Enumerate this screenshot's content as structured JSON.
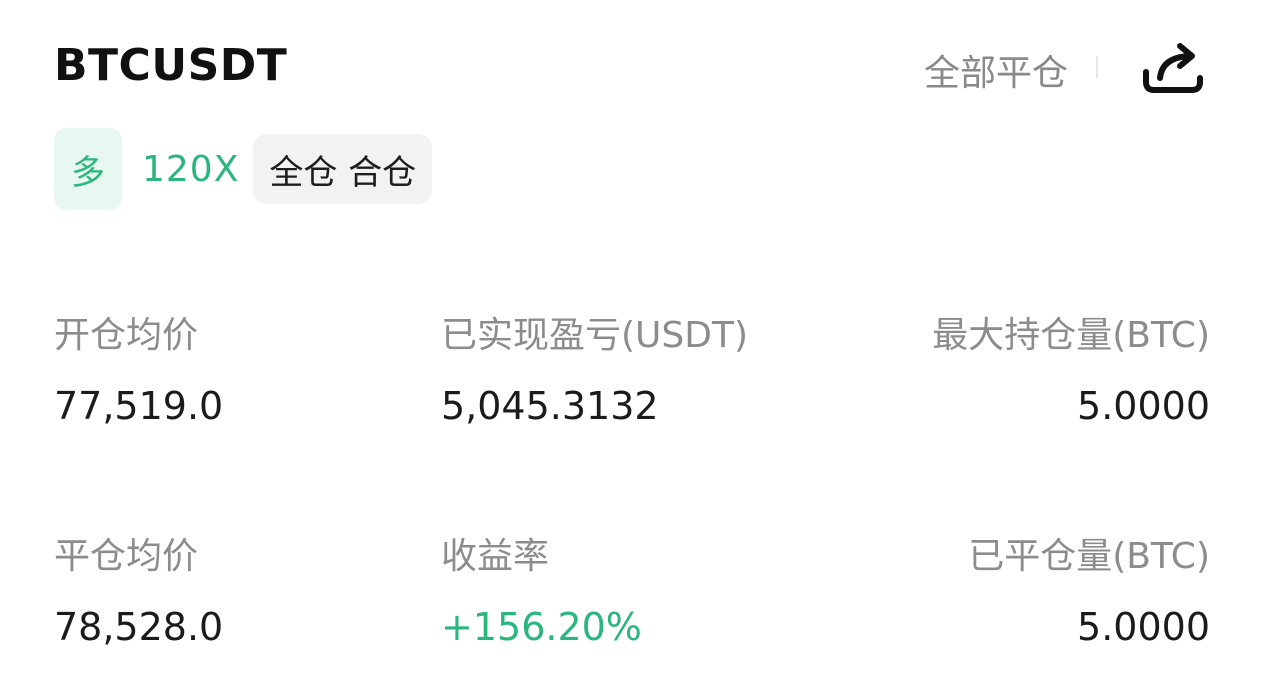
{
  "header": {
    "symbol": "BTCUSDT",
    "close_all_label": "全部平仓",
    "share_icon": "share-icon"
  },
  "tags": {
    "side": "多",
    "leverage": "120X",
    "margin_mode": "全仓 合仓"
  },
  "stats": {
    "open_avg_price": {
      "label": "开仓均价",
      "value": "77,519.0"
    },
    "realized_pnl": {
      "label": "已实现盈亏(USDT)",
      "value": "5,045.3132"
    },
    "max_position": {
      "label": "最大持仓量(BTC)",
      "value": "5.0000"
    },
    "close_avg_price": {
      "label": "平仓均价",
      "value": "78,528.0"
    },
    "roi": {
      "label": "收益率",
      "value": "+156.20%"
    },
    "closed_position": {
      "label": "已平仓量(BTC)",
      "value": "5.0000"
    }
  },
  "colors": {
    "accent_green": "#2bb57f",
    "muted_text": "#8c8c8c"
  }
}
